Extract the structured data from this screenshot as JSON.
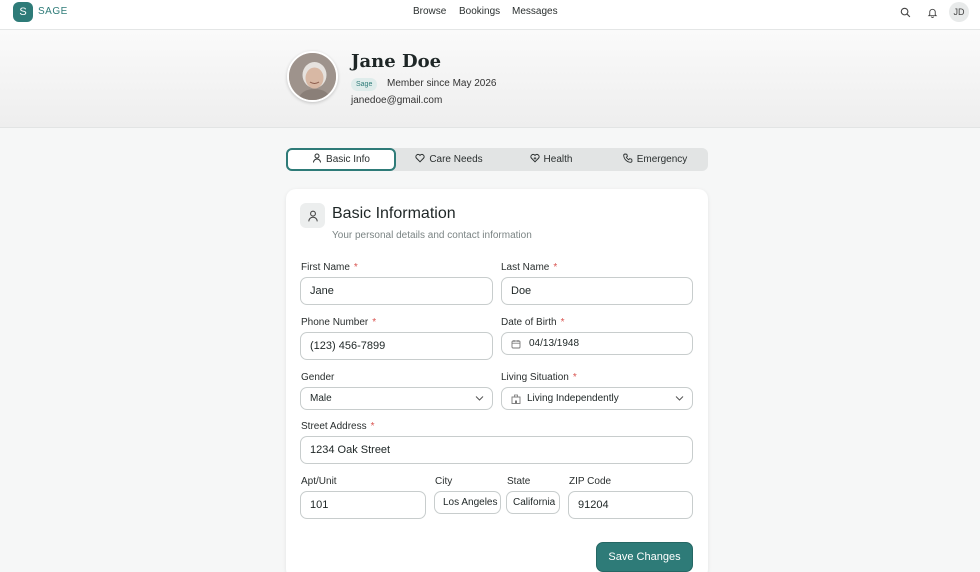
{
  "app": {
    "logo_letter": "S",
    "brand": "SAGE"
  },
  "nav": {
    "links": [
      "Browse",
      "Bookings",
      "Messages"
    ],
    "user_initials": "JD"
  },
  "profile": {
    "name": "Jane Doe",
    "badge": "Sage",
    "member_since": "Member since May 2026",
    "email": "janedoe@gmail.com"
  },
  "tabs": [
    {
      "label": "Basic Info",
      "icon": "user-icon",
      "active": true
    },
    {
      "label": "Care Needs",
      "icon": "heart-icon",
      "active": false
    },
    {
      "label": "Health",
      "icon": "health-icon",
      "active": false
    },
    {
      "label": "Emergency",
      "icon": "phone-icon",
      "active": false
    }
  ],
  "section": {
    "title": "Basic Information",
    "subtitle": "Your personal details and contact information"
  },
  "form": {
    "first_name": {
      "label": "First Name",
      "required": "*",
      "value": "Jane"
    },
    "last_name": {
      "label": "Last Name",
      "required": "*",
      "value": "Doe"
    },
    "phone": {
      "label": "Phone Number",
      "required": "*",
      "value": "(123) 456-7899"
    },
    "dob": {
      "label": "Date of Birth",
      "required": "*",
      "value": "04/13/1948"
    },
    "gender": {
      "label": "Gender",
      "value": "Male"
    },
    "living": {
      "label": "Living Situation",
      "required": "*",
      "value": "Living Independently"
    },
    "street": {
      "label": "Street Address",
      "required": "*",
      "value": "1234 Oak Street"
    },
    "apt": {
      "label": "Apt/Unit",
      "value": "101"
    },
    "city": {
      "label": "City",
      "value": "Los Angeles"
    },
    "state": {
      "label": "State",
      "value": "California"
    },
    "zip": {
      "label": "ZIP Code",
      "value": "91204"
    }
  },
  "actions": {
    "save": "Save Changes"
  },
  "colors": {
    "accent": "#2e7b78",
    "required": "#d9534f"
  }
}
